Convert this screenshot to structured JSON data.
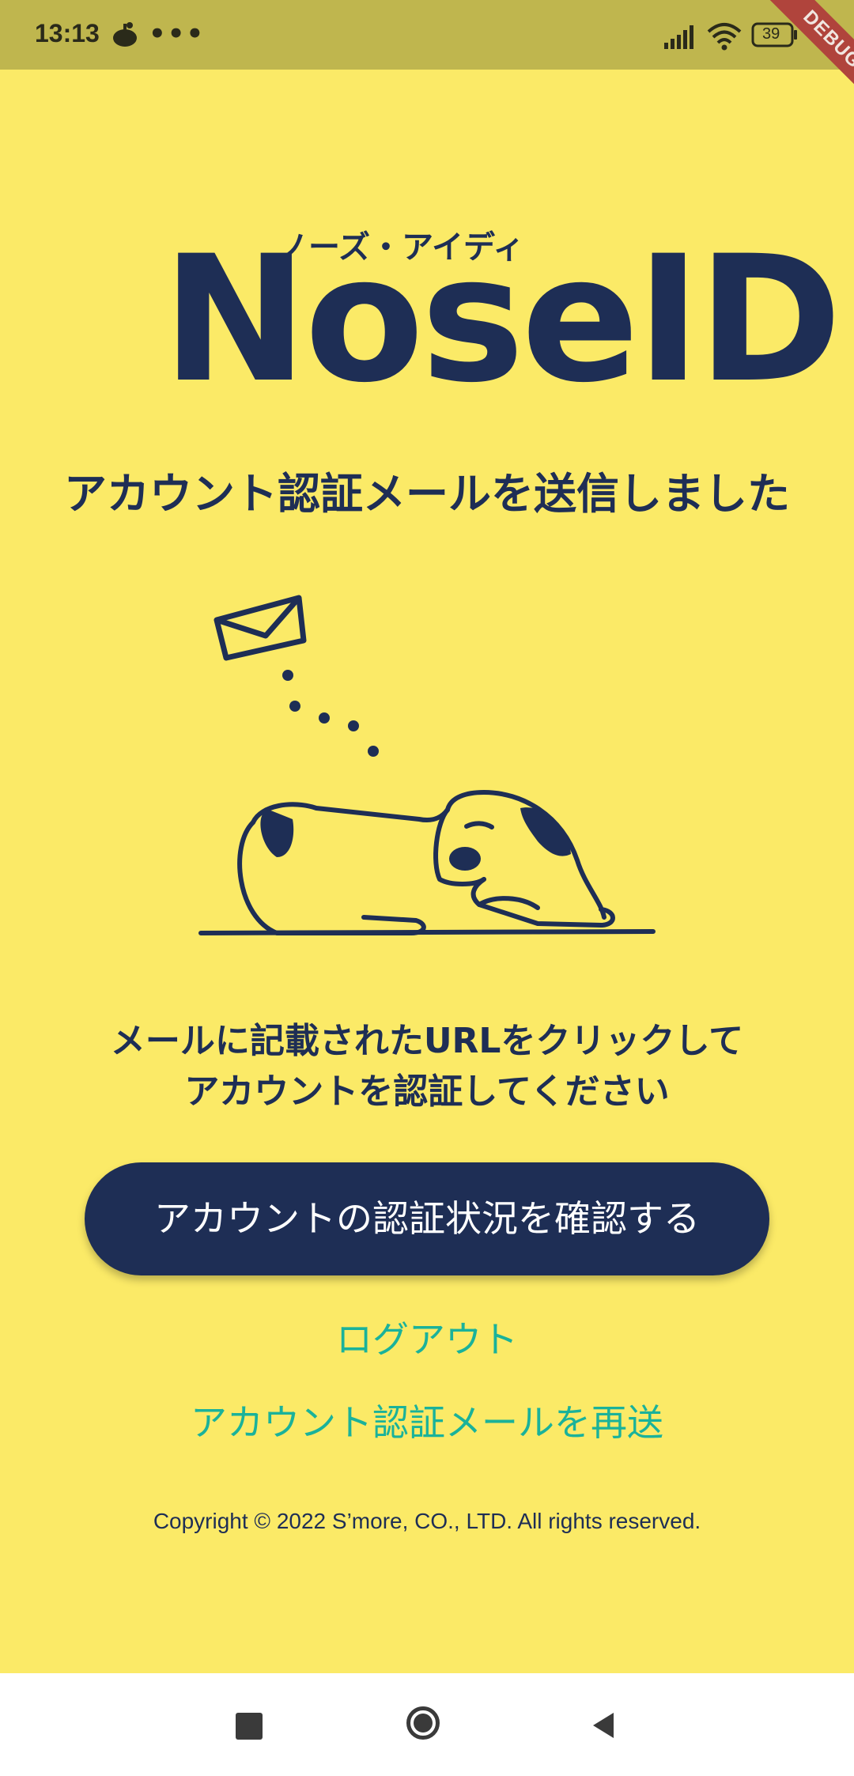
{
  "status_bar": {
    "time": "13:13",
    "more": "•••",
    "battery": "39",
    "debug_banner": "DEBUG"
  },
  "logo": {
    "word": "NoseID",
    "kana": "ノーズ・アイディ"
  },
  "headline": "アカウント認証メールを送信しました",
  "instructions": {
    "line1": "メールに記載されたURLをクリックして",
    "line2": "アカウントを認証してください"
  },
  "buttons": {
    "check_status": "アカウントの認証状況を確認する"
  },
  "links": {
    "logout": "ログアウト",
    "resend": "アカウント認証メールを再送"
  },
  "footer": {
    "copyright": "Copyright © 2022 S’more, CO., LTD. All rights reserved."
  },
  "icons": {
    "envelope": "envelope-icon",
    "dog": "sleeping-dog-illustration",
    "nav_recent": "square-icon",
    "nav_home": "circle-icon",
    "nav_back": "triangle-back-icon"
  },
  "colors": {
    "background": "#fbea67",
    "status_bar": "#bfb64e",
    "primary": "#1e2e55",
    "link": "#1ab29a"
  }
}
